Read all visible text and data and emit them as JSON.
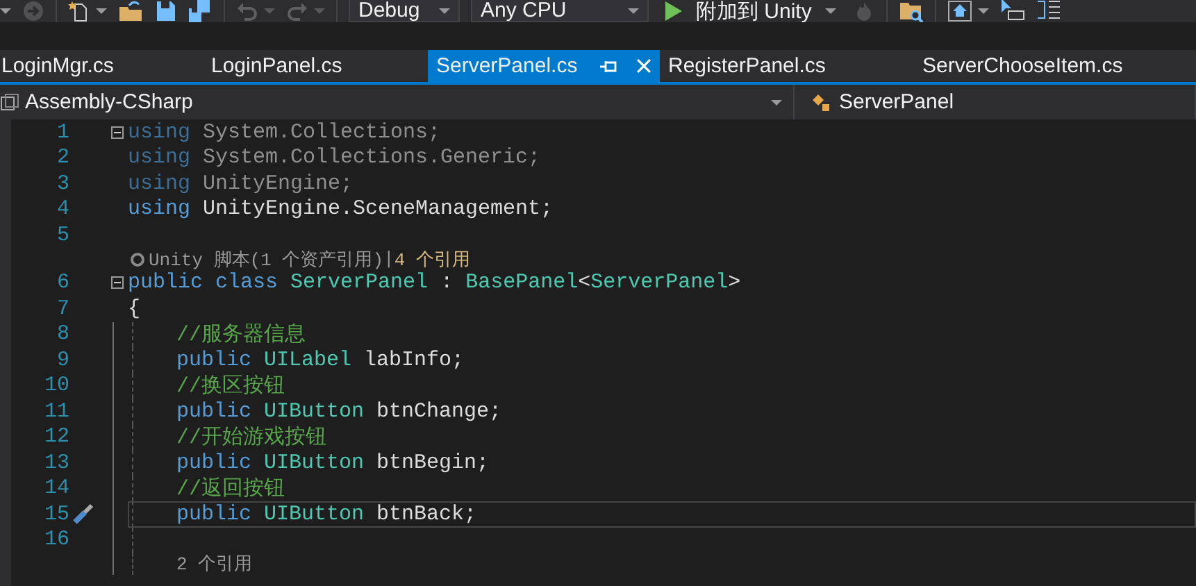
{
  "toolbar": {
    "groups": [
      {
        "items": [
          {
            "kind": "caret",
            "disabled": false
          },
          {
            "kind": "navigate",
            "disabled": true
          }
        ]
      },
      {
        "items": [
          {
            "kind": "new-item",
            "disabled": false
          },
          {
            "kind": "caret",
            "disabled": false
          },
          {
            "kind": "open",
            "disabled": false
          },
          {
            "kind": "save",
            "disabled": false
          },
          {
            "kind": "save-all",
            "disabled": false
          }
        ]
      },
      {
        "items": [
          {
            "kind": "undo",
            "disabled": true
          },
          {
            "kind": "caret",
            "disabled": true
          },
          {
            "kind": "redo",
            "disabled": true
          },
          {
            "kind": "caret",
            "disabled": true
          }
        ]
      }
    ],
    "configuration": "Debug",
    "platform": "Any CPU",
    "run_label": "附加到 Unity",
    "tail_groups": [
      {
        "items": [
          {
            "kind": "flame",
            "disabled": true
          }
        ]
      },
      {
        "items": [
          {
            "kind": "find-folder",
            "disabled": false
          }
        ]
      },
      {
        "items": [
          {
            "kind": "home",
            "disabled": false
          },
          {
            "kind": "caret",
            "disabled": false
          },
          {
            "kind": "pointer",
            "disabled": false
          },
          {
            "kind": "panes",
            "disabled": false
          }
        ]
      }
    ]
  },
  "tabs": [
    {
      "label": "LoginMgr.cs",
      "selected": false
    },
    {
      "label": "LoginPanel.cs",
      "selected": false
    },
    {
      "label": "ServerPanel.cs",
      "selected": true
    },
    {
      "label": "RegisterPanel.cs",
      "selected": false
    },
    {
      "label": "ServerChooseItem.cs",
      "selected": false
    }
  ],
  "navigation": {
    "project": "Assembly-CSharp",
    "type": "ServerPanel"
  },
  "code": [
    {
      "kind": "line",
      "number": "1",
      "foldable": true,
      "unused": true,
      "current": false,
      "tokens": [
        {
          "kind": "keyword",
          "text": "using"
        },
        {
          "kind": "plain",
          "text": " System.Collections;"
        }
      ]
    },
    {
      "kind": "line",
      "number": "2",
      "foldable": false,
      "unused": true,
      "current": false,
      "tokens": [
        {
          "kind": "keyword",
          "text": "using"
        },
        {
          "kind": "plain",
          "text": " System.Collections.Generic;"
        }
      ]
    },
    {
      "kind": "line",
      "number": "3",
      "foldable": false,
      "unused": true,
      "current": false,
      "tokens": [
        {
          "kind": "keyword",
          "text": "using"
        },
        {
          "kind": "plain",
          "text": " UnityEngine;"
        }
      ]
    },
    {
      "kind": "line",
      "number": "4",
      "foldable": false,
      "unused": false,
      "current": false,
      "tokens": [
        {
          "kind": "keyword",
          "text": "using"
        },
        {
          "kind": "plain",
          "text": " UnityEngine.SceneManagement;"
        }
      ]
    },
    {
      "kind": "line",
      "number": "5",
      "foldable": false,
      "current": false
    },
    {
      "kind": "lens",
      "parts": [
        {
          "text": "Unity 脚本(1 个资产引用)",
          "highlighted": false
        },
        {
          "text": "|",
          "highlighted": false
        },
        {
          "text": "4 个引用",
          "highlighted": true
        }
      ]
    },
    {
      "kind": "line",
      "number": "6",
      "foldable": true,
      "unused": false,
      "current": false,
      "tokens": [
        {
          "kind": "keyword",
          "text": "public class"
        },
        {
          "kind": "type",
          "text": " ServerPanel"
        },
        {
          "kind": "plain",
          "text": " : "
        },
        {
          "kind": "type",
          "text": "BasePanel"
        },
        {
          "kind": "plain",
          "text": "<"
        },
        {
          "kind": "type",
          "text": "ServerPanel"
        },
        {
          "kind": "plain",
          "text": ">"
        }
      ]
    },
    {
      "kind": "line",
      "number": "7",
      "foldable": false,
      "unused": false,
      "current": false,
      "tokens": [
        {
          "kind": "plain",
          "text": "{"
        }
      ],
      "children": [
        {
          "kind": "line",
          "number": "8",
          "foldable": false,
          "unused": false,
          "current": false,
          "tokens": [
            {
              "kind": "comment",
              "text": "//服务器信息"
            }
          ]
        },
        {
          "kind": "line",
          "number": "9",
          "foldable": false,
          "unused": false,
          "current": false,
          "tokens": [
            {
              "kind": "keyword",
              "text": "public"
            },
            {
              "kind": "type",
              "text": " UILabel"
            },
            {
              "kind": "plain",
              "text": " labInfo;"
            }
          ]
        },
        {
          "kind": "line",
          "number": "10",
          "foldable": false,
          "unused": false,
          "current": false,
          "tokens": [
            {
              "kind": "comment",
              "text": "//换区按钮"
            }
          ]
        },
        {
          "kind": "line",
          "number": "11",
          "foldable": false,
          "unused": false,
          "current": false,
          "tokens": [
            {
              "kind": "keyword",
              "text": "public"
            },
            {
              "kind": "type",
              "text": " UIButton"
            },
            {
              "kind": "plain",
              "text": " btnChange;"
            }
          ]
        },
        {
          "kind": "line",
          "number": "12",
          "foldable": false,
          "unused": false,
          "current": false,
          "tokens": [
            {
              "kind": "comment",
              "text": "//开始游戏按钮"
            }
          ]
        },
        {
          "kind": "line",
          "number": "13",
          "foldable": false,
          "unused": false,
          "current": false,
          "tokens": [
            {
              "kind": "keyword",
              "text": "public"
            },
            {
              "kind": "type",
              "text": " UIButton"
            },
            {
              "kind": "plain",
              "text": " btnBegin;"
            }
          ]
        },
        {
          "kind": "line",
          "number": "14",
          "foldable": false,
          "unused": false,
          "current": false,
          "tokens": [
            {
              "kind": "comment",
              "text": "//返回按钮"
            }
          ]
        },
        {
          "kind": "line",
          "number": "15",
          "foldable": false,
          "unused": false,
          "current": true,
          "tokens": [
            {
              "kind": "keyword",
              "text": "public"
            },
            {
              "kind": "type",
              "text": " UIButton"
            },
            {
              "kind": "plain",
              "text": " btnBack;"
            }
          ]
        },
        {
          "kind": "line",
          "number": "16",
          "foldable": false,
          "current": false
        },
        {
          "kind": "lens",
          "parts": [
            {
              "text": "2 个引用",
              "highlighted": false
            }
          ]
        }
      ]
    }
  ]
}
